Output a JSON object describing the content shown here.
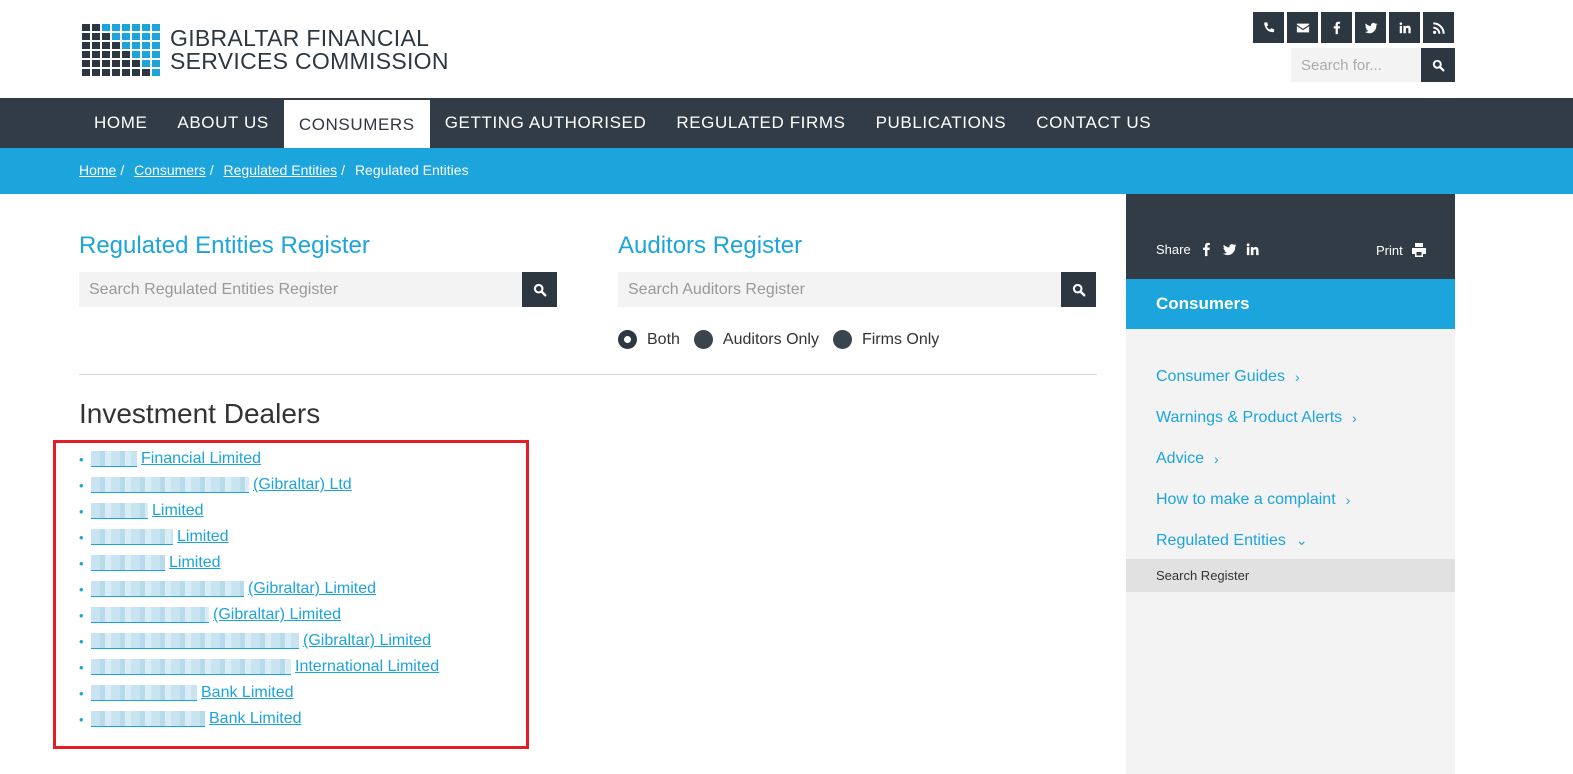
{
  "header": {
    "logo_line1": "GIBRALTAR FINANCIAL",
    "logo_line2": "SERVICES COMMISSION",
    "social_icons": [
      "phone-icon",
      "envelope-icon",
      "facebook-icon",
      "twitter-icon",
      "linkedin-icon",
      "rss-icon"
    ],
    "search_placeholder": "Search for..."
  },
  "nav": {
    "items": [
      "HOME",
      "ABOUT US",
      "CONSUMERS",
      "GETTING AUTHORISED",
      "REGULATED FIRMS",
      "PUBLICATIONS",
      "CONTACT US"
    ],
    "active": "CONSUMERS"
  },
  "breadcrumb": {
    "items": [
      "Home",
      "Consumers",
      "Regulated Entities"
    ],
    "current": "Regulated Entities"
  },
  "regulated_register": {
    "title": "Regulated Entities Register",
    "placeholder": "Search Regulated Entities Register"
  },
  "auditors_register": {
    "title": "Auditors Register",
    "placeholder": "Search Auditors Register",
    "options": [
      "Both",
      "Auditors Only",
      "Firms Only"
    ],
    "selected": "Both"
  },
  "investment_dealers": {
    "title": "Investment Dealers",
    "items": [
      "Financial Limited",
      "(Gibraltar) Ltd",
      "Limited",
      "Limited",
      "Limited",
      "(Gibraltar) Limited",
      "(Gibraltar) Limited",
      "(Gibraltar) Limited",
      "International Limited",
      "Bank Limited",
      "Bank Limited"
    ]
  },
  "sidebar": {
    "share_label": "Share",
    "print_label": "Print",
    "heading": "Consumers",
    "menu": [
      "Consumer Guides",
      "Warnings & Product Alerts",
      "Advice",
      "How to make a complaint",
      "Regulated Entities"
    ],
    "submenu": "Search Register"
  },
  "colors": {
    "brand_blue": "#1ca4dc",
    "dark": "#323c46",
    "highlight_red": "#e31e24"
  }
}
